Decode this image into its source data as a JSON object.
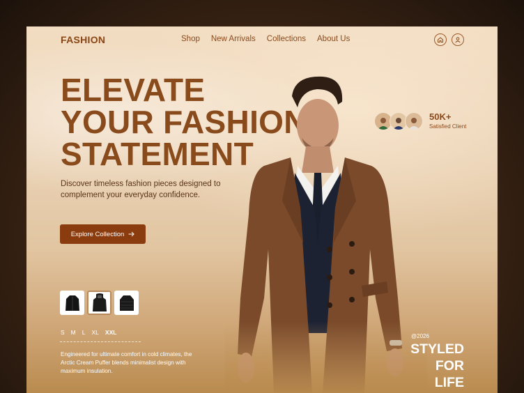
{
  "brand": "FASHION",
  "nav": {
    "items": [
      "Shop",
      "New Arrivals",
      "Collections",
      "About Us"
    ]
  },
  "icons": {
    "home": "home-icon",
    "profile": "user-icon"
  },
  "hero": {
    "title_lines": [
      "ELEVATE",
      "YOUR FASHION",
      "STATEMENT"
    ],
    "subtitle": "Discover timeless fashion pieces designed to complement your everyday confidence.",
    "cta": "Explore Collection"
  },
  "product": {
    "thumbnails": [
      "jacket-icon",
      "hooded-coat-icon",
      "puffer-jacket-icon"
    ],
    "selected_thumbnail": 1,
    "sizes": [
      "S",
      "M",
      "L",
      "XL",
      "XXL"
    ],
    "selected_size": "XXL",
    "description": "Engineered for ultimate comfort in cold climates, the Arctic Cream Puffer blends minimalist design with maximum insulation."
  },
  "social_proof": {
    "count": "50K+",
    "label": "Satisfied Client"
  },
  "badge": {
    "year": "@2026",
    "lines": [
      "STYLED",
      "FOR LIFE"
    ]
  },
  "colors": {
    "accent": "#8a3c0e",
    "brand_text": "#8a4b1c",
    "coat": "#7a4a2a"
  }
}
